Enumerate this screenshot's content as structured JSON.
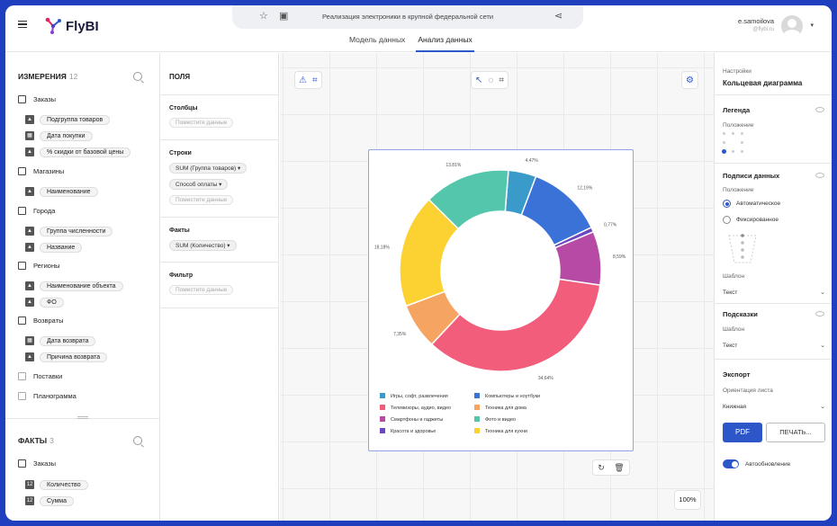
{
  "app": {
    "name": "FlyBI"
  },
  "document": {
    "title": "Реализация электроники в крупной федеральной сети"
  },
  "tabs": [
    {
      "label": "Модель данных"
    },
    {
      "label": "Анализ данных"
    }
  ],
  "user": {
    "name": "e.samoilova",
    "email": "@flybi.ru"
  },
  "dimensions": {
    "title": "ИЗМЕРЕНИЯ",
    "count": "12",
    "groups": [
      {
        "name": "Заказы",
        "fields": [
          "Подгруппа товаров",
          "Дата покупки",
          "% скидки от базовой цены"
        ]
      },
      {
        "name": "Магазины",
        "fields": [
          "Наименование"
        ]
      },
      {
        "name": "Города",
        "fields": [
          "Группа численности",
          "Название"
        ]
      },
      {
        "name": "Регионы",
        "fields": [
          "Наименование объекта",
          "ФО"
        ]
      },
      {
        "name": "Возвраты",
        "fields": [
          "Дата возврата",
          "Причина возврата"
        ]
      },
      {
        "name": "Поставки",
        "fields": []
      },
      {
        "name": "Планограмма",
        "fields": []
      }
    ]
  },
  "facts": {
    "title": "ФАКТЫ",
    "count": "3",
    "groups": [
      {
        "name": "Заказы",
        "fields": [
          "Количество",
          "Сумма"
        ]
      }
    ]
  },
  "fields_panel": {
    "title": "ПОЛЯ",
    "columns": {
      "label": "Столбцы",
      "placeholder": "Поместите данные"
    },
    "rows": {
      "label": "Строки",
      "chips": [
        "SUM (Группа товаров)",
        "Способ оплаты"
      ],
      "placeholder": "Поместите данные"
    },
    "facts": {
      "label": "Факты",
      "chips": [
        "SUM (Количество)"
      ]
    },
    "filter": {
      "label": "Фильтр",
      "placeholder": "Поместите данные"
    }
  },
  "canvas": {
    "zoom": "100%"
  },
  "chart_data": {
    "type": "pie",
    "variant": "donut",
    "slices": [
      {
        "label": "Игры, софт, развлечения",
        "value": 4.47,
        "text": "4,47%",
        "color": "#3a9ac9"
      },
      {
        "label": "Компьютеры и ноутбуки",
        "value": 12.19,
        "text": "12,19%",
        "color": "#3a72d8"
      },
      {
        "label": "Красота и здоровье",
        "value": 0.77,
        "text": "0,77%",
        "color": "#6b47c4"
      },
      {
        "label": "Смартфоны и гаджеты",
        "value": 8.59,
        "text": "8,59%",
        "color": "#b64aa5"
      },
      {
        "label": "Телевизоры, аудио, видео",
        "value": 34.64,
        "text": "34,64%",
        "color": "#f25d7c"
      },
      {
        "label": "Техника для дома",
        "value": 7.35,
        "text": "7,35%",
        "color": "#f5a462"
      },
      {
        "label": "Техника для кухни",
        "value": 18.18,
        "text": "18,18%",
        "color": "#fbd231"
      },
      {
        "label": "Фото и видео",
        "value": 13.81,
        "text": "13,81%",
        "color": "#53c6ab"
      }
    ],
    "legend": [
      {
        "label": "Игры, софт, развлечения",
        "color": "#3a9ac9"
      },
      {
        "label": "Компьютеры и ноутбуки",
        "color": "#3a72d8"
      },
      {
        "label": "Телевизоры, аудио, видео",
        "color": "#f25d7c"
      },
      {
        "label": "Техника для дома",
        "color": "#f5a462"
      },
      {
        "label": "Смартфоны и гаджеты",
        "color": "#b64aa5"
      },
      {
        "label": "Фото и видео",
        "color": "#53c6ab"
      },
      {
        "label": "Красота и здоровье",
        "color": "#6b47c4"
      },
      {
        "label": "Техника для кухни",
        "color": "#fbd231"
      }
    ],
    "legend_position": "bottom"
  },
  "settings": {
    "header": "Настройки",
    "chart_type": "Кольцевая диаграмма",
    "legend": {
      "title": "Легенда",
      "position_label": "Положение"
    },
    "data_labels": {
      "title": "Подписи данных",
      "position_label": "Положение",
      "options": [
        "Автоматическое",
        "Фиксированное"
      ],
      "selected": "Автоматическое",
      "template_label": "Шаблон",
      "template_value": "Текст"
    },
    "tooltips": {
      "title": "Подсказки",
      "template_label": "Шаблон",
      "template_value": "Текст"
    },
    "export": {
      "title": "Экспорт",
      "orientation_label": "Ориентация листа",
      "orientation_value": "Книжная",
      "pdf_label": "PDF",
      "print_label": "ПЕЧАТЬ..."
    },
    "auto_update_label": "Автообновление"
  },
  "colors": {
    "accent": "#2d57c8",
    "frame": "#1f3fbf"
  }
}
